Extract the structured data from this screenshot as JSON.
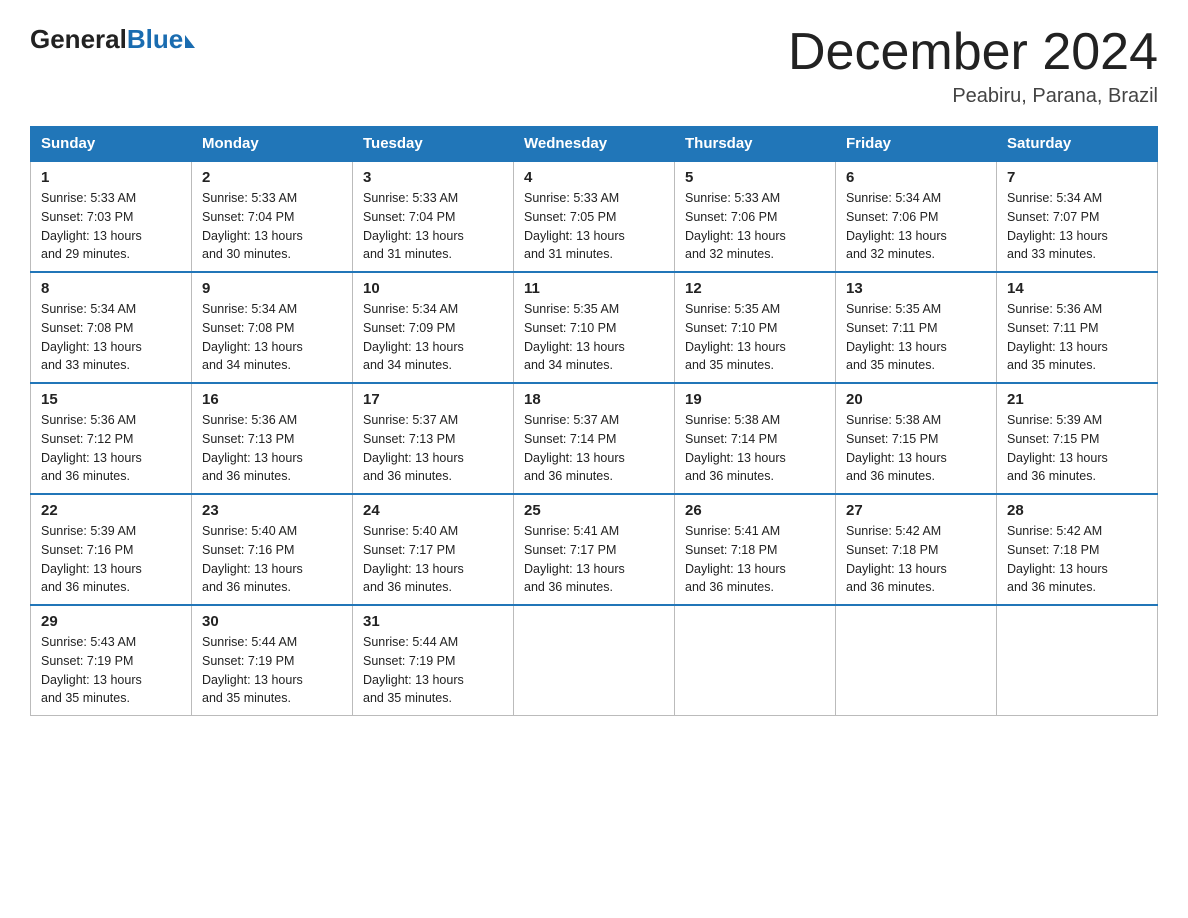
{
  "logo": {
    "general": "General",
    "blue": "Blue"
  },
  "title": {
    "month_year": "December 2024",
    "location": "Peabiru, Parana, Brazil"
  },
  "headers": [
    "Sunday",
    "Monday",
    "Tuesday",
    "Wednesday",
    "Thursday",
    "Friday",
    "Saturday"
  ],
  "weeks": [
    [
      {
        "day": "1",
        "sunrise": "5:33 AM",
        "sunset": "7:03 PM",
        "daylight": "13 hours and 29 minutes."
      },
      {
        "day": "2",
        "sunrise": "5:33 AM",
        "sunset": "7:04 PM",
        "daylight": "13 hours and 30 minutes."
      },
      {
        "day": "3",
        "sunrise": "5:33 AM",
        "sunset": "7:04 PM",
        "daylight": "13 hours and 31 minutes."
      },
      {
        "day": "4",
        "sunrise": "5:33 AM",
        "sunset": "7:05 PM",
        "daylight": "13 hours and 31 minutes."
      },
      {
        "day": "5",
        "sunrise": "5:33 AM",
        "sunset": "7:06 PM",
        "daylight": "13 hours and 32 minutes."
      },
      {
        "day": "6",
        "sunrise": "5:34 AM",
        "sunset": "7:06 PM",
        "daylight": "13 hours and 32 minutes."
      },
      {
        "day": "7",
        "sunrise": "5:34 AM",
        "sunset": "7:07 PM",
        "daylight": "13 hours and 33 minutes."
      }
    ],
    [
      {
        "day": "8",
        "sunrise": "5:34 AM",
        "sunset": "7:08 PM",
        "daylight": "13 hours and 33 minutes."
      },
      {
        "day": "9",
        "sunrise": "5:34 AM",
        "sunset": "7:08 PM",
        "daylight": "13 hours and 34 minutes."
      },
      {
        "day": "10",
        "sunrise": "5:34 AM",
        "sunset": "7:09 PM",
        "daylight": "13 hours and 34 minutes."
      },
      {
        "day": "11",
        "sunrise": "5:35 AM",
        "sunset": "7:10 PM",
        "daylight": "13 hours and 34 minutes."
      },
      {
        "day": "12",
        "sunrise": "5:35 AM",
        "sunset": "7:10 PM",
        "daylight": "13 hours and 35 minutes."
      },
      {
        "day": "13",
        "sunrise": "5:35 AM",
        "sunset": "7:11 PM",
        "daylight": "13 hours and 35 minutes."
      },
      {
        "day": "14",
        "sunrise": "5:36 AM",
        "sunset": "7:11 PM",
        "daylight": "13 hours and 35 minutes."
      }
    ],
    [
      {
        "day": "15",
        "sunrise": "5:36 AM",
        "sunset": "7:12 PM",
        "daylight": "13 hours and 36 minutes."
      },
      {
        "day": "16",
        "sunrise": "5:36 AM",
        "sunset": "7:13 PM",
        "daylight": "13 hours and 36 minutes."
      },
      {
        "day": "17",
        "sunrise": "5:37 AM",
        "sunset": "7:13 PM",
        "daylight": "13 hours and 36 minutes."
      },
      {
        "day": "18",
        "sunrise": "5:37 AM",
        "sunset": "7:14 PM",
        "daylight": "13 hours and 36 minutes."
      },
      {
        "day": "19",
        "sunrise": "5:38 AM",
        "sunset": "7:14 PM",
        "daylight": "13 hours and 36 minutes."
      },
      {
        "day": "20",
        "sunrise": "5:38 AM",
        "sunset": "7:15 PM",
        "daylight": "13 hours and 36 minutes."
      },
      {
        "day": "21",
        "sunrise": "5:39 AM",
        "sunset": "7:15 PM",
        "daylight": "13 hours and 36 minutes."
      }
    ],
    [
      {
        "day": "22",
        "sunrise": "5:39 AM",
        "sunset": "7:16 PM",
        "daylight": "13 hours and 36 minutes."
      },
      {
        "day": "23",
        "sunrise": "5:40 AM",
        "sunset": "7:16 PM",
        "daylight": "13 hours and 36 minutes."
      },
      {
        "day": "24",
        "sunrise": "5:40 AM",
        "sunset": "7:17 PM",
        "daylight": "13 hours and 36 minutes."
      },
      {
        "day": "25",
        "sunrise": "5:41 AM",
        "sunset": "7:17 PM",
        "daylight": "13 hours and 36 minutes."
      },
      {
        "day": "26",
        "sunrise": "5:41 AM",
        "sunset": "7:18 PM",
        "daylight": "13 hours and 36 minutes."
      },
      {
        "day": "27",
        "sunrise": "5:42 AM",
        "sunset": "7:18 PM",
        "daylight": "13 hours and 36 minutes."
      },
      {
        "day": "28",
        "sunrise": "5:42 AM",
        "sunset": "7:18 PM",
        "daylight": "13 hours and 36 minutes."
      }
    ],
    [
      {
        "day": "29",
        "sunrise": "5:43 AM",
        "sunset": "7:19 PM",
        "daylight": "13 hours and 35 minutes."
      },
      {
        "day": "30",
        "sunrise": "5:44 AM",
        "sunset": "7:19 PM",
        "daylight": "13 hours and 35 minutes."
      },
      {
        "day": "31",
        "sunrise": "5:44 AM",
        "sunset": "7:19 PM",
        "daylight": "13 hours and 35 minutes."
      },
      null,
      null,
      null,
      null
    ]
  ]
}
